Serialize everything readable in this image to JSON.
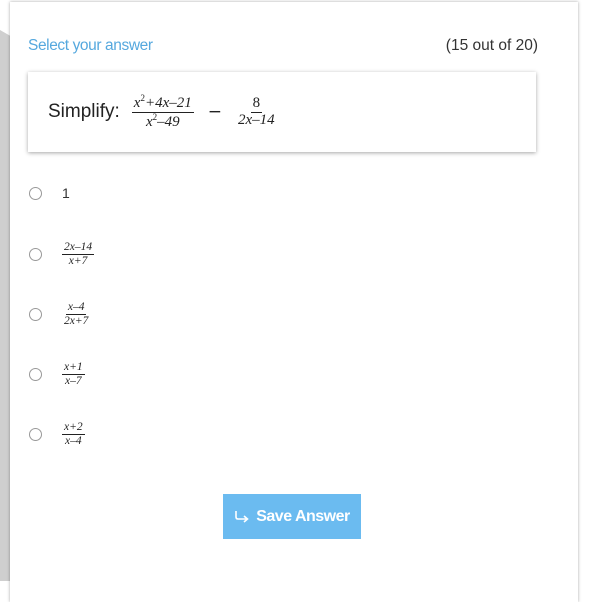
{
  "header": {
    "select_label": "Select your answer",
    "progress": "(15 out of 20)"
  },
  "question": {
    "prefix": "Simplify:",
    "term1_numerator_part1": "x",
    "term1_numerator_exp": "2",
    "term1_numerator_part2": "+4x–21",
    "term1_denominator_part1": "x",
    "term1_denominator_exp": "2",
    "term1_denominator_part2": "–49",
    "operator": "−",
    "term2_numerator": "8",
    "term2_denominator": "2x–14"
  },
  "options": [
    {
      "text": "1"
    },
    {
      "numerator": "2x–14",
      "denominator": "x+7"
    },
    {
      "numerator": "x–4",
      "denominator": "2x+7"
    },
    {
      "numerator": "x+1",
      "denominator": "x–7"
    },
    {
      "numerator": "x+2",
      "denominator": "x–4"
    }
  ],
  "save_button": {
    "label": "Save Answer",
    "icon": "arrow-return-right-icon"
  },
  "colors": {
    "accent": "#55a8de",
    "button_bg": "#6bbbf0"
  }
}
